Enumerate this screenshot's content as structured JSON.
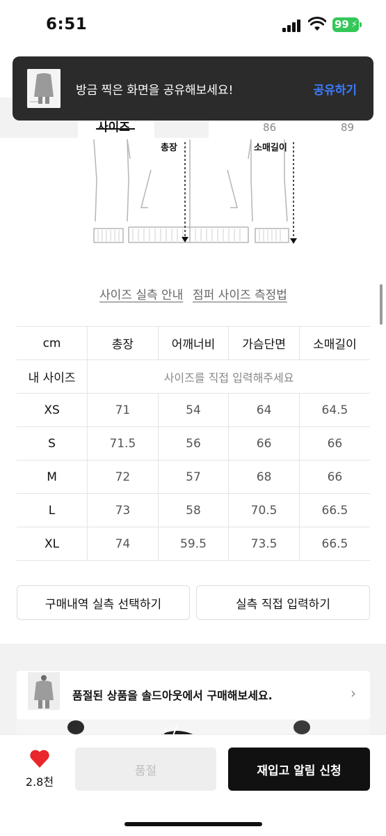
{
  "status_bar": {
    "time": "6:51",
    "battery": "99"
  },
  "toast": {
    "message": "방금 찍은 화면을 공유해보세요!",
    "action": "공유하기"
  },
  "tabs": {
    "active_label": "사이즈",
    "sub_numbers": [
      "86",
      "89"
    ]
  },
  "diagram": {
    "label_length": "총장",
    "label_sleeve": "소매길이"
  },
  "links": {
    "size_guide": "사이즈 실측 안내",
    "measure_method": "점퍼 사이즈 측정법"
  },
  "table": {
    "headers": [
      "cm",
      "총장",
      "어깨너비",
      "가슴단면",
      "소매길이"
    ],
    "my_size": {
      "label": "내 사이즈",
      "placeholder": "사이즈를 직접 입력해주세요"
    },
    "rows": [
      {
        "size": "XS",
        "values": [
          "71",
          "54",
          "64",
          "64.5"
        ]
      },
      {
        "size": "S",
        "values": [
          "71.5",
          "56",
          "66",
          "66"
        ]
      },
      {
        "size": "M",
        "values": [
          "72",
          "57",
          "68",
          "66"
        ]
      },
      {
        "size": "L",
        "values": [
          "73",
          "58",
          "70.5",
          "66.5"
        ]
      },
      {
        "size": "XL",
        "values": [
          "74",
          "59.5",
          "73.5",
          "66.5"
        ]
      }
    ]
  },
  "buttons": {
    "purchase_history": "구매내역 실측 선택하기",
    "direct_input": "실측 직접 입력하기"
  },
  "soldout_banner": {
    "text": "품절된 상품을 솔드아웃에서 구매해보세요."
  },
  "bottom_bar": {
    "like_count": "2.8천",
    "sold_out_label": "품절",
    "restock_label": "재입고 알림 신청"
  },
  "colors": {
    "accent_blue": "#3b7cff",
    "heart_red": "#e8262b",
    "battery_green": "#34c759"
  }
}
